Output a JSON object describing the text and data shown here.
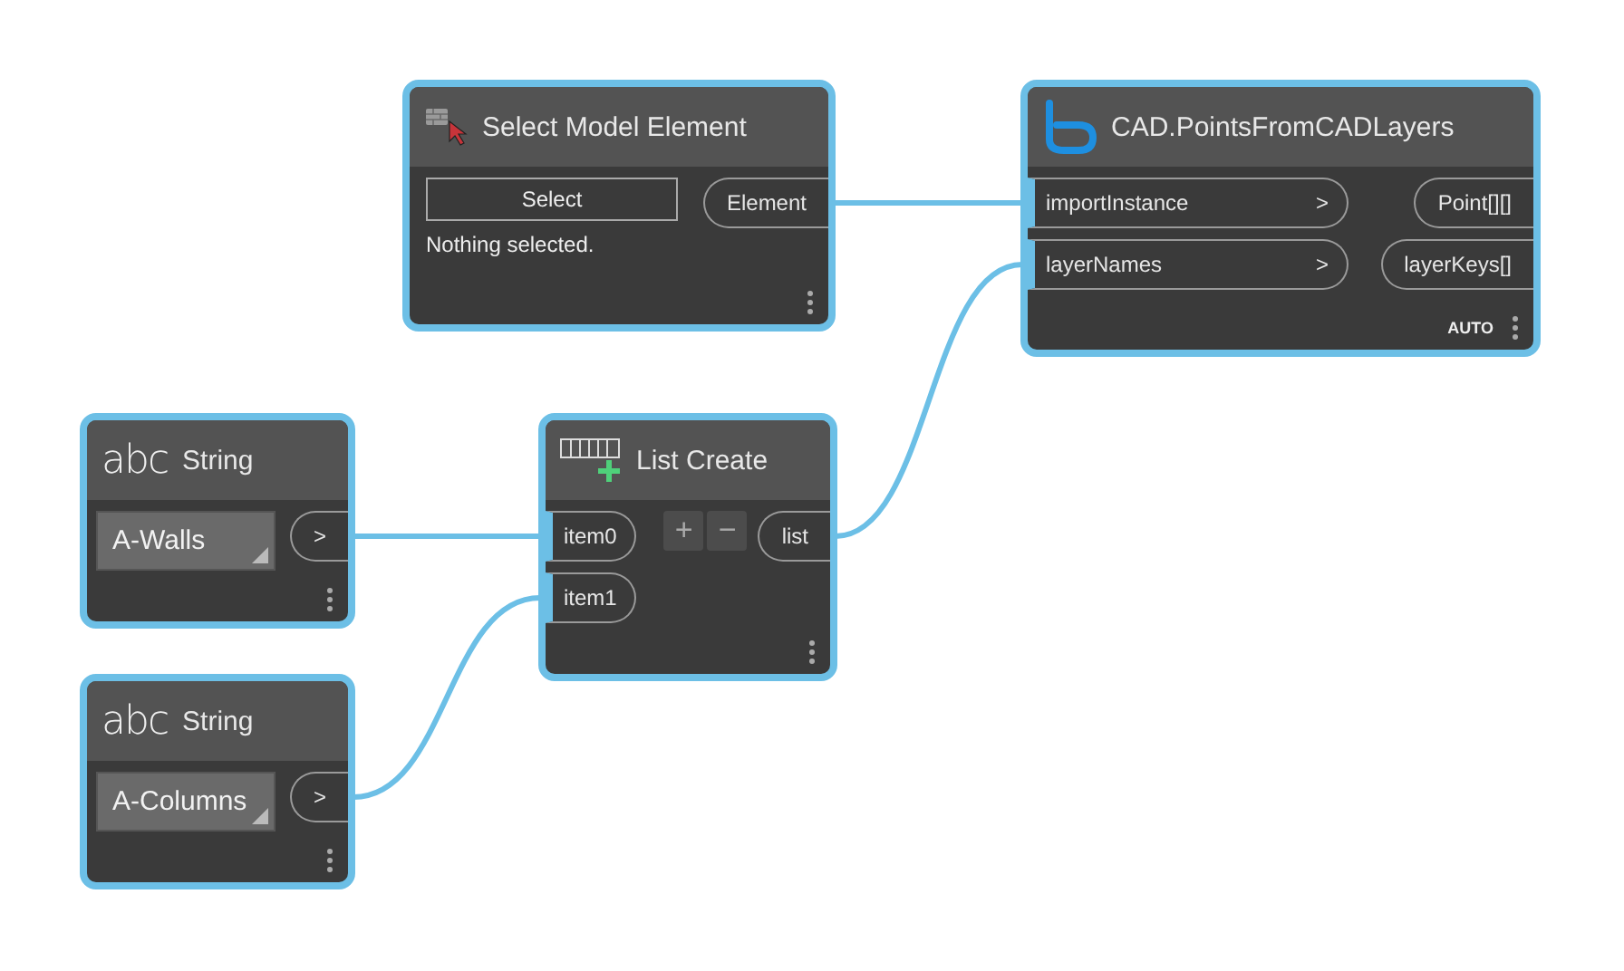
{
  "nodes": [
    {
      "kind": "select",
      "title": "Select Model Element",
      "button": "Select",
      "status": "Nothing selected.",
      "outputs": [
        "Element"
      ]
    },
    {
      "kind": "function",
      "title": "CAD.PointsFromCADLayers",
      "inputs": [
        {
          "name": "importInstance",
          "arrow": ">",
          "connected": true
        },
        {
          "name": "layerNames",
          "arrow": ">",
          "connected": true
        }
      ],
      "outputs": [
        "Point[][]",
        "layerKeys[]"
      ],
      "lacing": "AUTO"
    },
    {
      "kind": "string",
      "icon_text": "abc",
      "title": "String",
      "value": "A-Walls",
      "outputs": [
        ">"
      ]
    },
    {
      "kind": "list",
      "title": "List Create",
      "inputs": [
        {
          "name": "item0",
          "connected": true
        },
        {
          "name": "item1",
          "connected": true
        }
      ],
      "add": "+",
      "remove": "−",
      "outputs": [
        "list"
      ]
    },
    {
      "kind": "string",
      "icon_text": "abc",
      "title": "String",
      "value": "A-Columns",
      "outputs": [
        ">"
      ]
    }
  ]
}
